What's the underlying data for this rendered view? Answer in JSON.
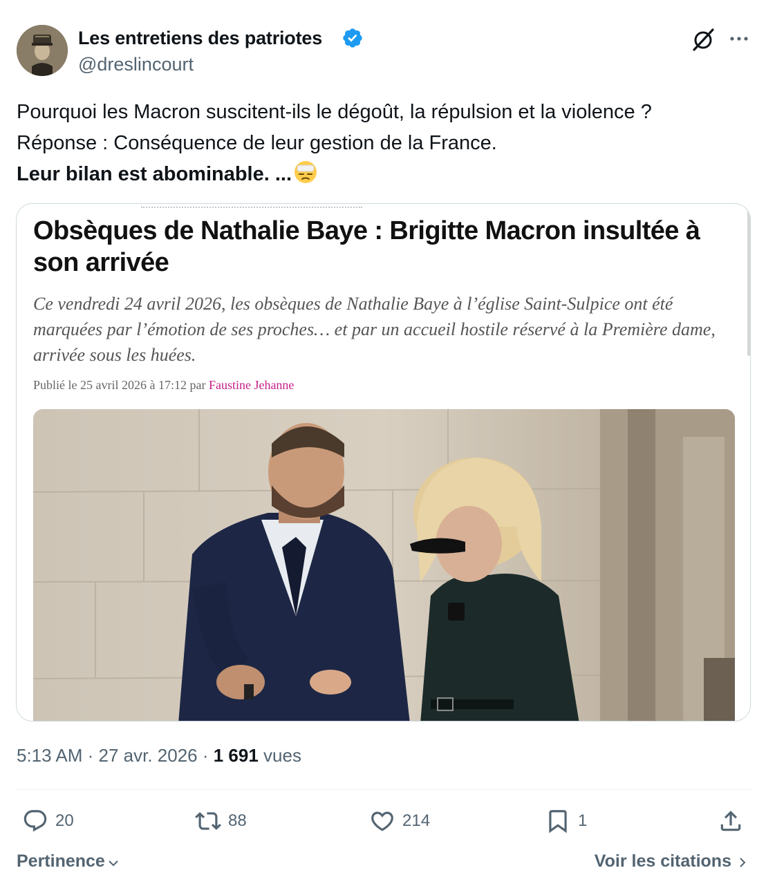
{
  "author": {
    "display_name": "Les entretiens des patriotes",
    "handle": "@dreslincourt",
    "verified": true,
    "verified_color": "#1d9bf0"
  },
  "header_icons": {
    "grok": "grok-icon",
    "more": "more-icon"
  },
  "tweet": {
    "line1": "Pourquoi les Macron suscitent-ils le dégoût, la répulsion et la violence ?",
    "line2": " Réponse : Conséquence de leur gestion de la France.",
    "line3": "Leur bilan est abominable. ...",
    "emoji": "😒"
  },
  "article": {
    "title": "Obsèques de Nathalie Baye : Brigitte Macron insultée à son arrivée",
    "lede": "Ce vendredi 24 avril 2026, les obsèques de Nathalie Baye à l’église Saint-Sulpice ont été marquées par l’émotion de ses proches… et par un accueil hostile réservé à la Première dame, arrivée sous les huées.",
    "byline_prefix": "Publié le 25 avril 2026 à 17:12 par",
    "byline_author": "Faustine Jehanne",
    "author_color": "#c41e8a"
  },
  "meta": {
    "time": "5:13 AM",
    "sep1": " · ",
    "date": "27 avr. 2026",
    "sep2": " · ",
    "views_count": "1 691",
    "views_label": " vues"
  },
  "actions": {
    "reply_count": "20",
    "retweet_count": "88",
    "like_count": "214",
    "bookmark_count": "1"
  },
  "footer": {
    "sort_label": "Pertinence",
    "quotes_label": "Voir les citations"
  }
}
